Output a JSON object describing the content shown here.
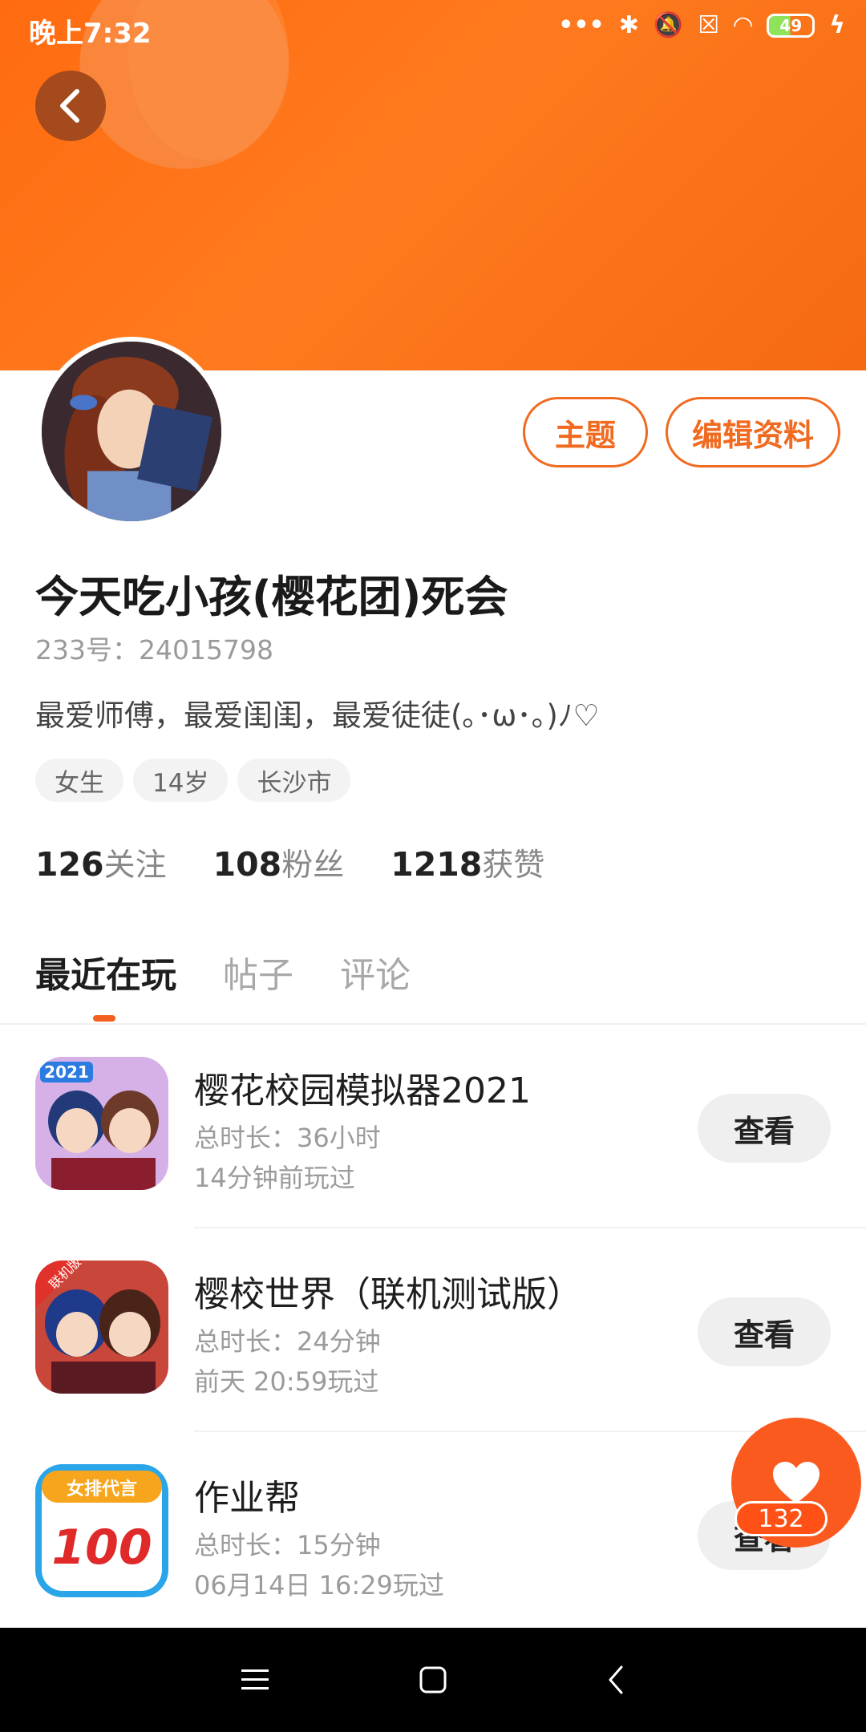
{
  "status_bar": {
    "time": "晚上7:32",
    "battery": "49"
  },
  "profile": {
    "theme_button": "主题",
    "edit_button": "编辑资料",
    "name": "今天吃小孩(樱花团)死会",
    "uid": "233号：24015798",
    "bio": "最爱师傅，最爱闺闺，最爱徒徒(｡･ω･｡)ﾉ♡",
    "tags": [
      "女生",
      "14岁",
      "长沙市"
    ],
    "stats": [
      {
        "num": "126",
        "label": "关注"
      },
      {
        "num": "108",
        "label": "粉丝"
      },
      {
        "num": "1218",
        "label": "获赞"
      }
    ]
  },
  "tabs": [
    "最近在玩",
    "帖子",
    "评论"
  ],
  "games": [
    {
      "title": "樱花校园模拟器2021",
      "duration": "总时长：36小时",
      "last_played": "14分钟前玩过",
      "button": "查看",
      "badge": "2021"
    },
    {
      "title": "樱校世界（联机测试版）",
      "duration": "总时长：24分钟",
      "last_played": "前天 20:59玩过",
      "button": "查看",
      "badge": "联机版"
    },
    {
      "title": "作业帮",
      "duration": "总时长：15分钟",
      "last_played": "06月14日 16:29玩过",
      "button": "查看",
      "badge": "女排代言"
    }
  ],
  "fab": {
    "count": "132"
  },
  "colors": {
    "accent": "#f06a1f",
    "banner": "#ff6b10"
  }
}
